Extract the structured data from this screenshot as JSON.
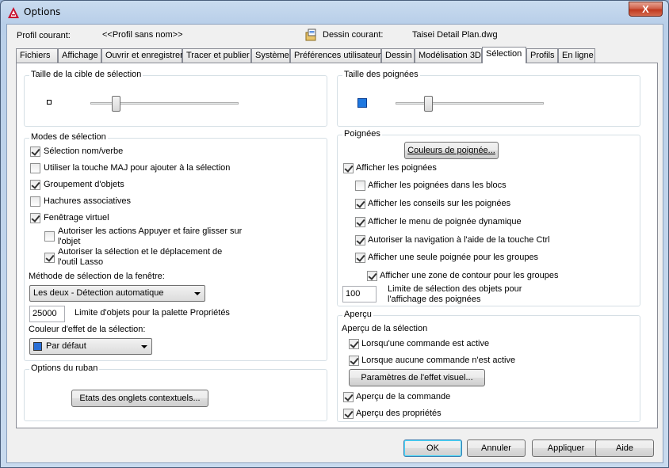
{
  "window": {
    "title": "Options",
    "close_label": "X"
  },
  "header": {
    "profile_label": "Profil courant:",
    "profile_value": "<<Profil sans nom>>",
    "drawing_label": "Dessin courant:",
    "drawing_value": "Taisei Detail Plan.dwg"
  },
  "tabs": [
    "Fichiers",
    "Affichage",
    "Ouvrir et enregistrer",
    "Tracer et publier",
    "Système",
    "Préférences utilisateur",
    "Dessin",
    "Modélisation 3D",
    "Sélection",
    "Profils",
    "En ligne"
  ],
  "active_tab": "Sélection",
  "left": {
    "pickbox": {
      "title": "Taille de la cible de sélection",
      "level": 0.17
    },
    "modes": {
      "title": "Modes de sélection",
      "items": [
        {
          "label": "Sélection nom/verbe",
          "checked": true
        },
        {
          "label": "Utiliser la touche MAJ pour ajouter à la sélection",
          "checked": false
        },
        {
          "label": "Groupement d'objets",
          "checked": true
        },
        {
          "label": "Hachures associatives",
          "checked": false
        },
        {
          "label": "Fenêtrage virtuel",
          "checked": true
        }
      ],
      "sub1_line1": "Autoriser les actions Appuyer et faire glisser sur",
      "sub1_line2": "l'objet",
      "sub1_checked": false,
      "sub2_line1": "Autoriser la sélection et le déplacement de",
      "sub2_line2": "l'outil Lasso",
      "sub2_checked": true,
      "window_method_label": "Méthode de sélection de la fenêtre:",
      "window_method_value": "Les deux - Détection automatique",
      "limit_value": "25000",
      "limit_label": "Limite d'objets pour la palette Propriétés",
      "effect_color_label": "Couleur d'effet de la sélection:",
      "effect_color_value": "Par défaut",
      "effect_color_swatch": "#2a6fd6"
    },
    "ribbon": {
      "title": "Options du ruban",
      "button": "Etats des onglets contextuels..."
    }
  },
  "right": {
    "grip_size": {
      "title": "Taille des poignées",
      "level": 0.22,
      "swatch": "#1e78e0"
    },
    "grips": {
      "title": "Poignées",
      "colors_button": "Couleurs de poignée...",
      "items": [
        {
          "label": "Afficher les poignées",
          "checked": true
        },
        {
          "label": "Afficher les poignées dans les blocs",
          "checked": false
        },
        {
          "label": "Afficher les conseils sur les poignées",
          "checked": true
        },
        {
          "label": "Afficher le menu de poignée dynamique",
          "checked": true
        },
        {
          "label": "Autoriser la navigation à l'aide de la touche Ctrl",
          "checked": true
        },
        {
          "label": "Afficher une seule poignée pour les groupes",
          "checked": true
        },
        {
          "label": "Afficher une zone de contour pour les groupes",
          "checked": true
        }
      ],
      "limit_value": "100",
      "limit_line1": "Limite de sélection des objets pour",
      "limit_line2": "l'affichage des poignées"
    },
    "preview": {
      "title": "Aperçu",
      "subtitle": "Aperçu de la sélection",
      "items": [
        {
          "label": "Lorsqu'une commande est active",
          "checked": true
        },
        {
          "label": "Lorsque aucune commande n'est active",
          "checked": true
        }
      ],
      "visual_button": "Paramètres de l'effet visuel...",
      "items2": [
        {
          "label": "Aperçu de la commande",
          "checked": true
        },
        {
          "label": "Aperçu des propriétés",
          "checked": true
        }
      ]
    }
  },
  "footer": {
    "ok": "OK",
    "cancel": "Annuler",
    "apply": "Appliquer",
    "help": "Aide"
  }
}
